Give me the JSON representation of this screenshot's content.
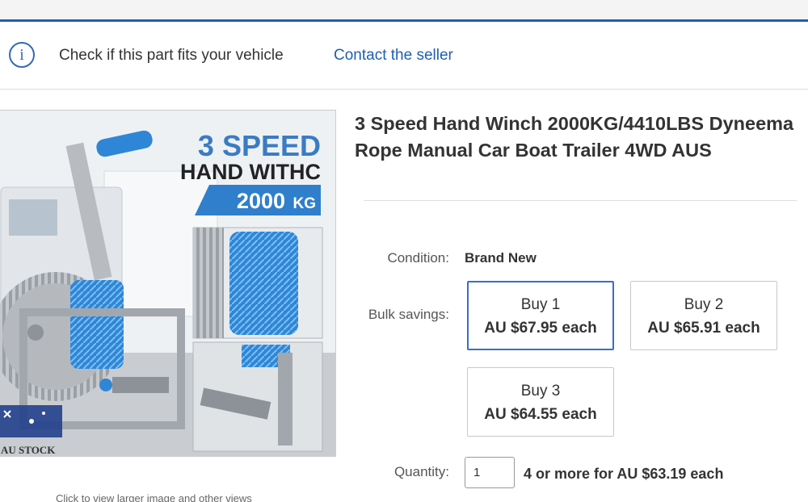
{
  "header": {
    "fit_check_text": "Check if this part fits your vehicle",
    "contact_link": "Contact the seller"
  },
  "gallery": {
    "caption": "Click to view larger image and other views",
    "headline_line1": "3 SPEED",
    "headline_line2": "HAND WITHC",
    "capacity_number": "2000",
    "capacity_unit": "KG",
    "badge_text": "AU STOCK"
  },
  "product": {
    "title": "3 Speed Hand Winch 2000KG/4410LBS Dyneema Rope Manual Car Boat Trailer 4WD AUS",
    "condition_label": "Condition:",
    "condition_value": "Brand New",
    "bulk_label": "Bulk savings:",
    "bulk_options": [
      {
        "qty": "Buy 1",
        "price": "AU $67.95 each",
        "selected": true
      },
      {
        "qty": "Buy 2",
        "price": "AU $65.91 each",
        "selected": false
      },
      {
        "qty": "Buy 3",
        "price": "AU $64.55 each",
        "selected": false
      }
    ],
    "quantity_label": "Quantity:",
    "quantity_value": "1",
    "quantity_offer": "4 or more for AU $63.19 each"
  },
  "colors": {
    "accent_blue": "#1f5fb0",
    "rope_blue": "#2f86d6",
    "text": "#333333"
  }
}
